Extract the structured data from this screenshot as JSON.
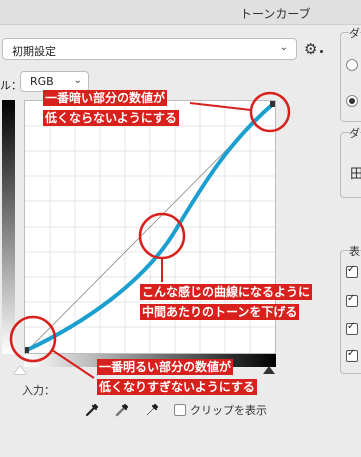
{
  "window": {
    "title": "トーンカーブ"
  },
  "preset": {
    "value": "初期設定"
  },
  "channel": {
    "label": "ル：",
    "value": "RGB"
  },
  "graph": {
    "input_label": "入力：",
    "clipping_label": "クリップを表示"
  },
  "right_panel": {
    "group1_initial": "ダ",
    "group2_initial": "ダ",
    "group2_field": "田",
    "group3_initial": "表"
  },
  "annotations": {
    "top_line1": "一番暗い部分の数値が",
    "top_line2": "低くならないようにする",
    "middle_line1": "こんな感じの曲線になるように",
    "middle_line2": "中間あたりのトーンを下げる",
    "bottom_line1": "一番明るい部分の数値が",
    "bottom_line2": "低くなりすぎないようにする"
  },
  "colors": {
    "curve": "#1a9fce",
    "annotation": "#d8211c"
  }
}
